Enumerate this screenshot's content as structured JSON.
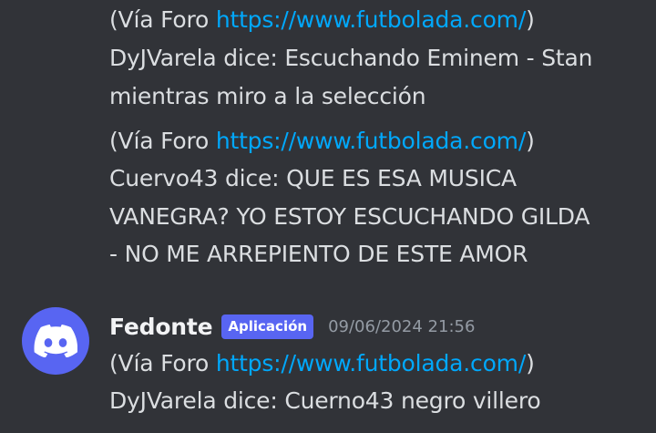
{
  "messages": [
    {
      "via_prefix": "(Vía Foro ",
      "link": "https://www.futbolada.com/",
      "via_suffix": ")",
      "lines": [
        "DyJVarela dice: Escuchando Eminem - Stan",
        "mientras miro a la selección"
      ]
    },
    {
      "via_prefix": "(Vía Foro ",
      "link": "https://www.futbolada.com/",
      "via_suffix": ")",
      "lines": [
        "Cuervo43 dice: QUE ES ESA MUSICA",
        "VANEGRA? YO ESTOY ESCUCHANDO GILDA",
        "- NO ME ARREPIENTO DE ESTE AMOR"
      ]
    }
  ],
  "group": {
    "author": "Fedonte",
    "badge": "Aplicación",
    "timestamp": "09/06/2024 21:56",
    "avatar_icon": "discord-logo-icon",
    "avatar_color": "#5865f2",
    "message": {
      "via_prefix": "(Vía Foro ",
      "link": "https://www.futbolada.com/",
      "via_suffix": ")",
      "lines": [
        "DyJVarela dice: Cuerno43 negro villero"
      ]
    }
  },
  "colors": {
    "background": "#313338",
    "text": "#dbdee1",
    "link": "#00a8fc",
    "timestamp": "#949ba4"
  }
}
